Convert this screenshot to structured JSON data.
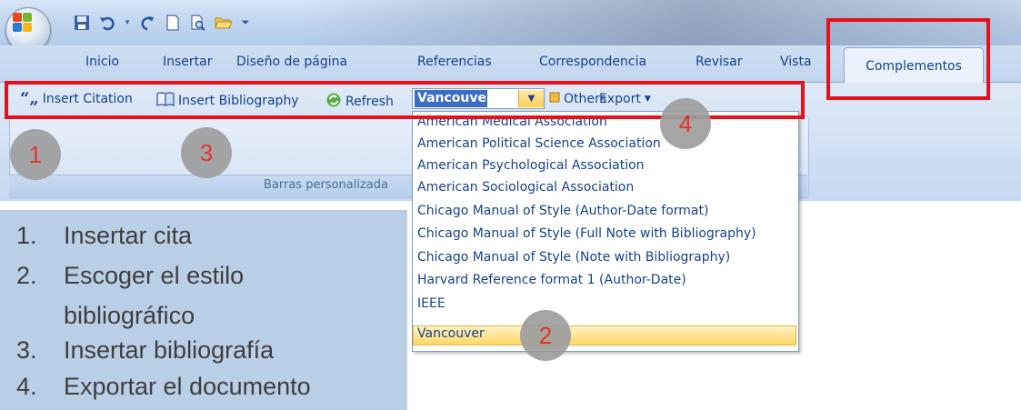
{
  "quick_access": {
    "icons": [
      "save-icon",
      "undo-icon",
      "redo-icon",
      "new-document-icon",
      "print-preview-icon",
      "open-folder-icon",
      "customize-dropdown-icon"
    ]
  },
  "tabs": [
    "Inicio",
    "Insertar",
    "Diseño de página",
    "Referencias",
    "Correspondencia",
    "Revisar",
    "Vista",
    "Complementos"
  ],
  "toolbar": {
    "insert_citation": "Insert Citation",
    "insert_bibliography": "Insert Bibliography",
    "refresh": "Refresh",
    "style_value": "Vancouver",
    "others": "Others",
    "export": "Export",
    "group_label": "Barras personalizada"
  },
  "dropdown": {
    "items": [
      "American Medical Association",
      "American Political Science Association",
      "American Psychological Association",
      "American Sociological Association",
      "Chicago Manual of Style (Author-Date format)",
      "Chicago Manual of Style (Full Note with Bibliography)",
      "Chicago Manual of Style (Note with Bibliography)",
      "Harvard Reference format 1 (Author-Date)",
      "IEEE",
      "Vancouver"
    ],
    "selected": "Vancouver"
  },
  "callouts": [
    "1",
    "2",
    "3",
    "4"
  ],
  "steps": [
    {
      "num": "1.",
      "text": "Insertar cita"
    },
    {
      "num": "2.",
      "text": "Escoger el estilo"
    },
    {
      "num": "",
      "text": "bibliográfico"
    },
    {
      "num": "3.",
      "text": "Insertar bibliografía"
    },
    {
      "num": "4.",
      "text": "Exportar el documento"
    }
  ],
  "colors": {
    "annotation_red": "#e8101a",
    "tab_text": "#15428b",
    "steps_panel": "#b9cfe6",
    "callout_gray": "#9e9e9e"
  }
}
